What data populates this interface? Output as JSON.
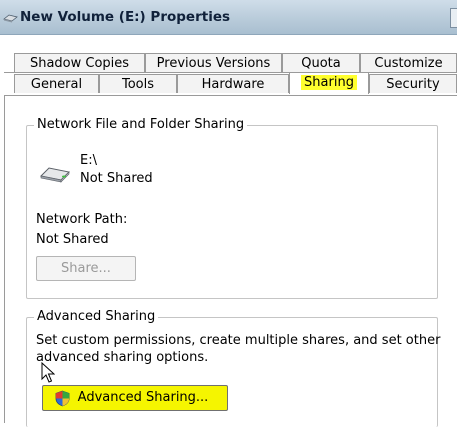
{
  "window": {
    "title": "New Volume (E:) Properties"
  },
  "tabs": {
    "row_back": [
      "Shadow Copies",
      "Previous Versions",
      "Quota",
      "Customize"
    ],
    "row_front": [
      "General",
      "Tools",
      "Hardware",
      "Sharing",
      "Security"
    ],
    "active": "Sharing"
  },
  "network_sharing": {
    "legend": "Network File and Folder Sharing",
    "drive_label": "E:\\",
    "share_status": "Not Shared",
    "path_label": "Network Path:",
    "path_value": "Not Shared",
    "share_button": "Share..."
  },
  "advanced_sharing": {
    "legend": "Advanced Sharing",
    "description_line1": "Set custom permissions, create multiple shares, and set other",
    "description_line2": "advanced sharing options.",
    "button_label": "Advanced Sharing..."
  },
  "colors": {
    "highlight": "#ffff2e",
    "title_bar": "#b7cad9"
  },
  "icons": [
    "drive-share-icon",
    "drive-icon",
    "uac-shield-icon",
    "mouse-pointer-icon"
  ]
}
